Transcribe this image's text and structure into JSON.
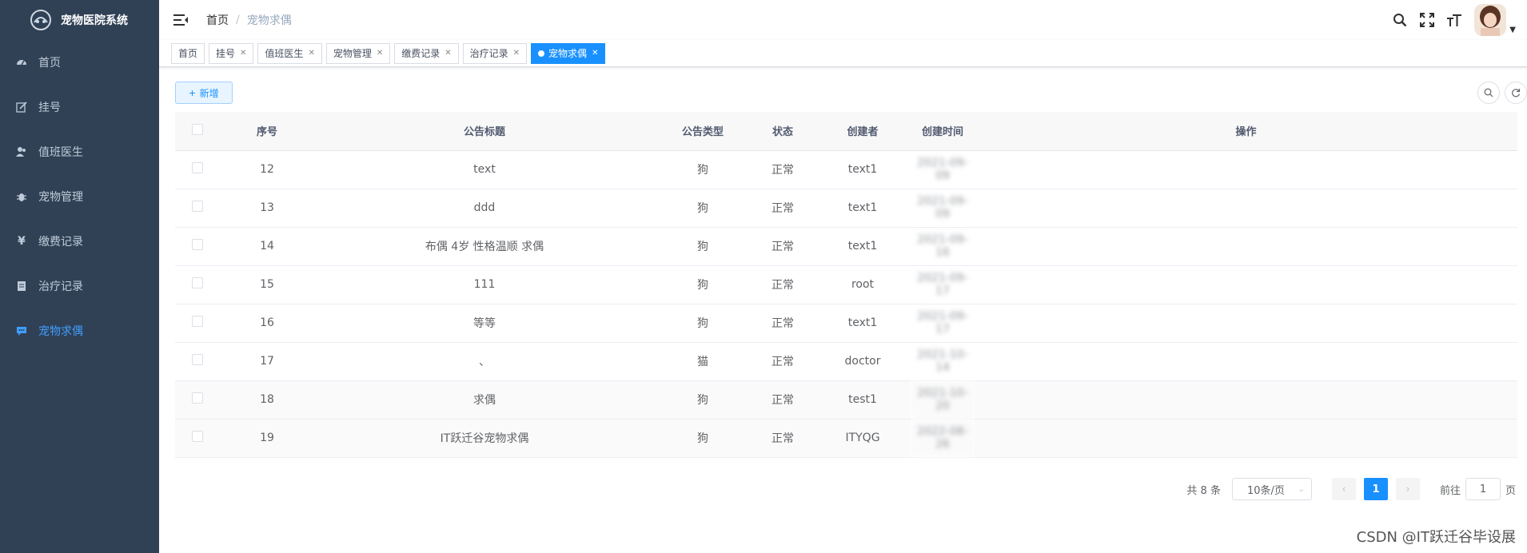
{
  "sidebar": {
    "title": "宠物医院系统",
    "items": [
      {
        "label": "首页",
        "icon": "dashboard-icon"
      },
      {
        "label": "挂号",
        "icon": "edit-icon"
      },
      {
        "label": "值班医生",
        "icon": "peoples-icon"
      },
      {
        "label": "宠物管理",
        "icon": "bug-icon"
      },
      {
        "label": "缴费记录",
        "icon": "yen-icon"
      },
      {
        "label": "治疗记录",
        "icon": "documentation-icon"
      },
      {
        "label": "宠物求偶",
        "icon": "message-icon"
      }
    ],
    "active_index": 6
  },
  "navbar": {
    "breadcrumb_home": "首页",
    "breadcrumb_sep": "/",
    "breadcrumb_current": "宠物求偶"
  },
  "tags": [
    {
      "label": "首页",
      "closable": false
    },
    {
      "label": "挂号",
      "closable": true
    },
    {
      "label": "值班医生",
      "closable": true
    },
    {
      "label": "宠物管理",
      "closable": true
    },
    {
      "label": "缴费记录",
      "closable": true
    },
    {
      "label": "治疗记录",
      "closable": true
    },
    {
      "label": "宠物求偶",
      "closable": true,
      "active": true
    }
  ],
  "toolbar": {
    "add_label": "新增"
  },
  "table": {
    "headers": [
      "序号",
      "公告标题",
      "公告类型",
      "状态",
      "创建者",
      "创建时间",
      "操作"
    ],
    "rows": [
      {
        "id": "12",
        "title": "text",
        "type": "狗",
        "status": "正常",
        "creator": "text1",
        "created": "2021-09-09"
      },
      {
        "id": "13",
        "title": "ddd",
        "type": "狗",
        "status": "正常",
        "creator": "text1",
        "created": "2021-09-09"
      },
      {
        "id": "14",
        "title": "布偶 4岁 性格温顺 求偶",
        "type": "狗",
        "status": "正常",
        "creator": "text1",
        "created": "2021-09-16"
      },
      {
        "id": "15",
        "title": "111",
        "type": "狗",
        "status": "正常",
        "creator": "root",
        "created": "2021-09-17"
      },
      {
        "id": "16",
        "title": "等等",
        "type": "狗",
        "status": "正常",
        "creator": "text1",
        "created": "2021-09-17"
      },
      {
        "id": "17",
        "title": "、",
        "type": "猫",
        "status": "正常",
        "creator": "doctor",
        "created": "2021-10-14"
      },
      {
        "id": "18",
        "title": "求偶",
        "type": "狗",
        "status": "正常",
        "creator": "test1",
        "created": "2021-10-20"
      },
      {
        "id": "19",
        "title": "IT跃迁谷宠物求偶",
        "type": "狗",
        "status": "正常",
        "creator": "ITYQG",
        "created": "2022-08-26"
      }
    ],
    "highlighted_row": 6
  },
  "pagination": {
    "total_text": "共 8 条",
    "page_size": "10条/页",
    "current_page": "1",
    "goto_label": "前往",
    "goto_value": "1",
    "page_unit": "页"
  },
  "watermark": "CSDN @IT跃迁谷毕设展",
  "colors": {
    "sidebar_bg": "#304156",
    "accent": "#1890ff",
    "menu_text": "#bfcbd9"
  }
}
